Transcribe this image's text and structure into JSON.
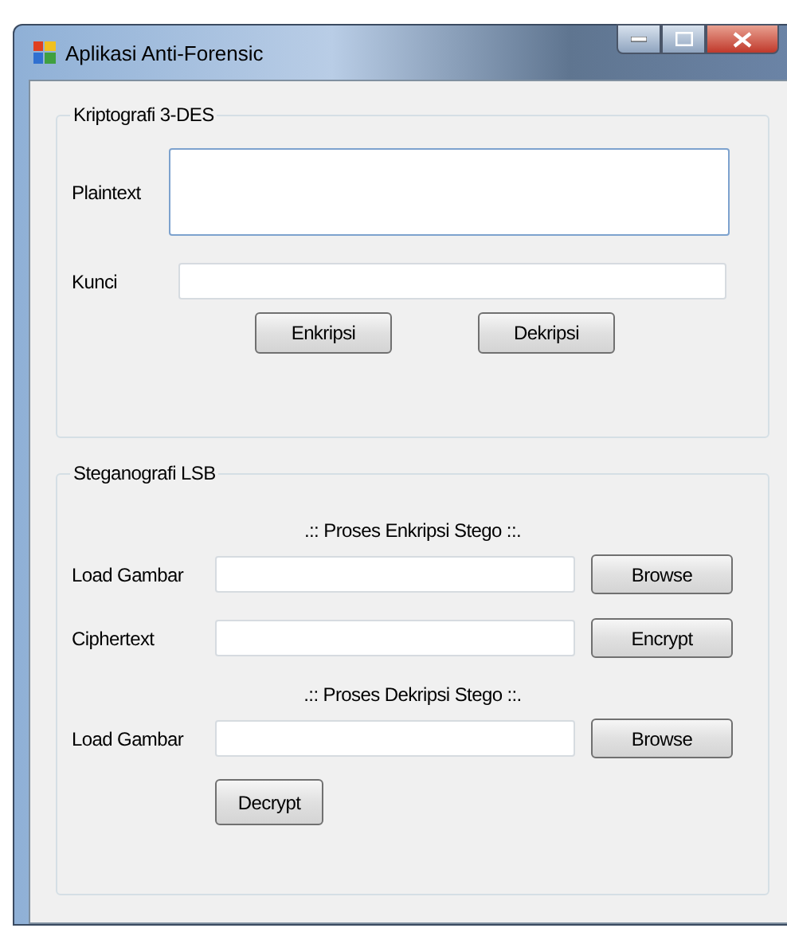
{
  "window": {
    "title": "Aplikasi Anti-Forensic"
  },
  "kripto": {
    "title": "Kriptografi 3-DES",
    "plaintext_label": "Plaintext",
    "kunci_label": "Kunci",
    "buttons": [
      "Enkripsi",
      "Dekripsi"
    ]
  },
  "stego": {
    "title": "Steganografi LSB",
    "rows": [
      {
        "kind": "heading",
        "text": ".:: Proses Enkripsi Stego ::."
      },
      {
        "kind": "field",
        "label": "Load Gambar",
        "button": "Browse"
      },
      {
        "kind": "field",
        "label": "Ciphertext",
        "button": "Encrypt"
      },
      {
        "kind": "heading",
        "text": ".:: Proses Dekripsi Stego ::."
      },
      {
        "kind": "field",
        "label": "Load Gambar",
        "button": "Browse"
      },
      {
        "kind": "action",
        "button": "Decrypt"
      }
    ]
  }
}
